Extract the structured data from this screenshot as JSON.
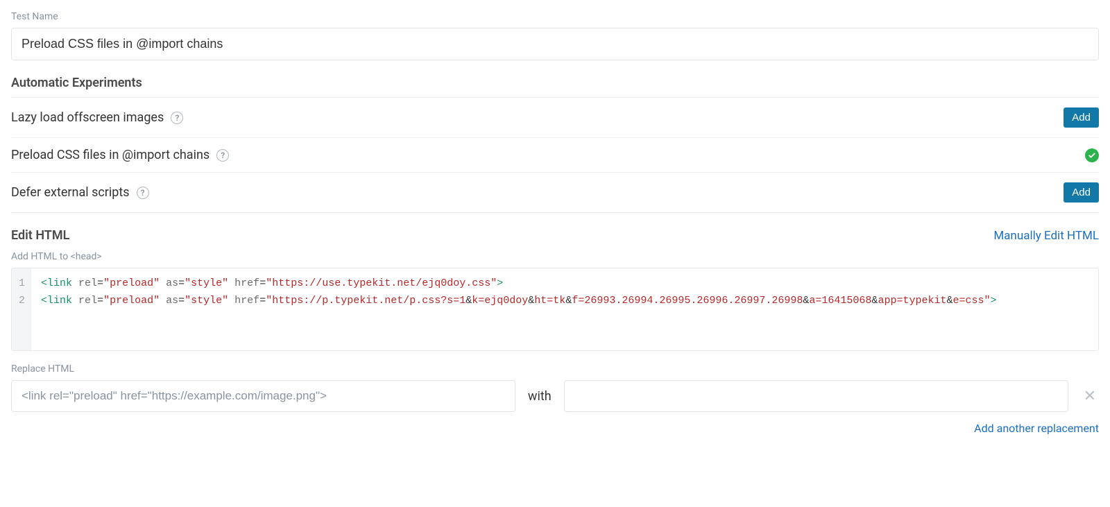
{
  "test_name_label": "Test Name",
  "test_name_value": "Preload CSS files in @import chains",
  "experiments_label": "Automatic Experiments",
  "experiments": [
    {
      "label": "Lazy load offscreen images",
      "added": false
    },
    {
      "label": "Preload CSS files in @import chains",
      "added": true
    },
    {
      "label": "Defer external scripts",
      "added": false
    }
  ],
  "add_button": "Add",
  "edit_html_label": "Edit HTML",
  "manually_edit_link": "Manually Edit HTML",
  "add_head_label": "Add HTML to <head>",
  "code": {
    "line_numbers": [
      "1",
      "2"
    ],
    "line1": {
      "tag": "link",
      "attrs": [
        {
          "name": "rel",
          "value": "preload"
        },
        {
          "name": "as",
          "value": "style"
        },
        {
          "name": "href",
          "value": "https://use.typekit.net/ejq0doy.css"
        }
      ]
    },
    "line2": {
      "tag": "link",
      "attrs_head": [
        {
          "name": "rel",
          "value": "preload"
        },
        {
          "name": "as",
          "value": "style"
        }
      ],
      "href_prefix": "https://p.typekit.net/p.css?s=1",
      "href_params": [
        {
          "k": "k",
          "v": "ejq0doy"
        },
        {
          "k": "ht",
          "v": "tk"
        },
        {
          "k": "f",
          "v": "26993.26994.26995.26996.26997.26998"
        },
        {
          "k": "a",
          "v": "16415068"
        },
        {
          "k": "app",
          "v": "typekit"
        },
        {
          "k": "e",
          "v": "css"
        }
      ]
    }
  },
  "replace_label": "Replace HTML",
  "replace_placeholder": "<link rel=\"preload\" href=\"https://example.com/image.png\">",
  "with_label": "with",
  "add_replacement_link": "Add another replacement"
}
